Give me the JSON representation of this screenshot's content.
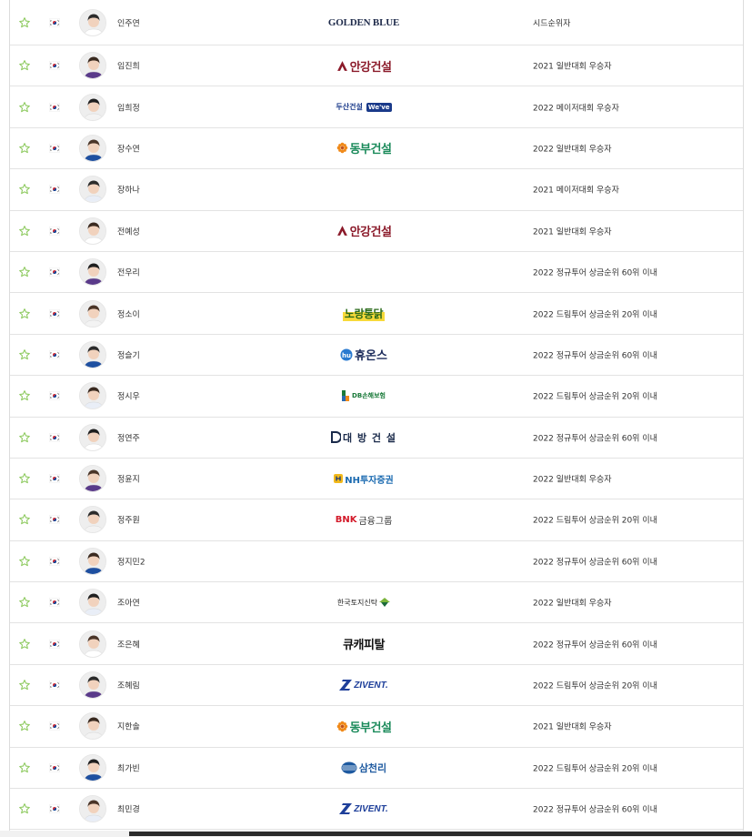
{
  "players": [
    {
      "name": "인주연",
      "sponsor": {
        "type": "golden",
        "text": "GOLDEN BLUE"
      },
      "qualification": "시드순위자"
    },
    {
      "name": "임진희",
      "sponsor": {
        "type": "ahn",
        "text": "안강건설"
      },
      "qualification": "2021 일반대회 우승자"
    },
    {
      "name": "임희정",
      "sponsor": {
        "type": "doosan",
        "text": "두산건설",
        "sub": "We've"
      },
      "qualification": "2022 메이저대회 우승자"
    },
    {
      "name": "장수연",
      "sponsor": {
        "type": "dongbu",
        "text": "동부건설"
      },
      "qualification": "2022 일반대회 우승자"
    },
    {
      "name": "장하나",
      "sponsor": {
        "type": "none",
        "text": ""
      },
      "qualification": "2021 메이저대회 우승자"
    },
    {
      "name": "전예성",
      "sponsor": {
        "type": "ahn",
        "text": "안강건설"
      },
      "qualification": "2021 일반대회 우승자"
    },
    {
      "name": "전우리",
      "sponsor": {
        "type": "none",
        "text": ""
      },
      "qualification": "2022 정규투어 상금순위 60위 이내"
    },
    {
      "name": "정소이",
      "sponsor": {
        "type": "nori",
        "text": "노랑통닭"
      },
      "qualification": "2022 드림투어 상금순위 20위 이내"
    },
    {
      "name": "정슬기",
      "sponsor": {
        "type": "huons",
        "text": "휴온스"
      },
      "qualification": "2022 정규투어 상금순위 60위 이내"
    },
    {
      "name": "정시우",
      "sponsor": {
        "type": "db",
        "text": "DB손해보험"
      },
      "qualification": "2022 드림투어 상금순위 20위 이내"
    },
    {
      "name": "정연주",
      "sponsor": {
        "type": "daebang",
        "text": "대 방 건 설"
      },
      "qualification": "2022 정규투어 상금순위 60위 이내"
    },
    {
      "name": "정윤지",
      "sponsor": {
        "type": "nh",
        "text": "NH투자증권"
      },
      "qualification": "2022 일반대회 우승자"
    },
    {
      "name": "정주원",
      "sponsor": {
        "type": "bnk",
        "text": "금융그룹",
        "sub": "BNK"
      },
      "qualification": "2022 드림투어 상금순위 20위 이내"
    },
    {
      "name": "정지민2",
      "sponsor": {
        "type": "none",
        "text": ""
      },
      "qualification": "2022 정규투어 상금순위 60위 이내"
    },
    {
      "name": "조아연",
      "sponsor": {
        "type": "hanto",
        "text": "한국토지신탁"
      },
      "qualification": "2022 일반대회 우승자"
    },
    {
      "name": "조은혜",
      "sponsor": {
        "type": "cue",
        "text": "큐캐피탈"
      },
      "qualification": "2022 정규투어 상금순위 60위 이내"
    },
    {
      "name": "조혜림",
      "sponsor": {
        "type": "zivent",
        "text": "ZIVENT."
      },
      "qualification": "2022 드림투어 상금순위 20위 이내"
    },
    {
      "name": "지한솔",
      "sponsor": {
        "type": "dongbu",
        "text": "동부건설"
      },
      "qualification": "2021 일반대회 우승자"
    },
    {
      "name": "최가빈",
      "sponsor": {
        "type": "samch",
        "text": "삼천리"
      },
      "qualification": "2022 드림투어 상금순위 20위 이내"
    },
    {
      "name": "최민경",
      "sponsor": {
        "type": "zivent",
        "text": "ZIVENT."
      },
      "qualification": "2022 정규투어 상금순위 60위 이내"
    }
  ],
  "icons": {
    "favorite": "star-outline-icon",
    "flag": "korea-flag-icon"
  },
  "colors": {
    "star": "#8ac85a",
    "flag_red": "#cd2e3a",
    "flag_blue": "#0047a0",
    "row_border": "#e3e3e3"
  }
}
